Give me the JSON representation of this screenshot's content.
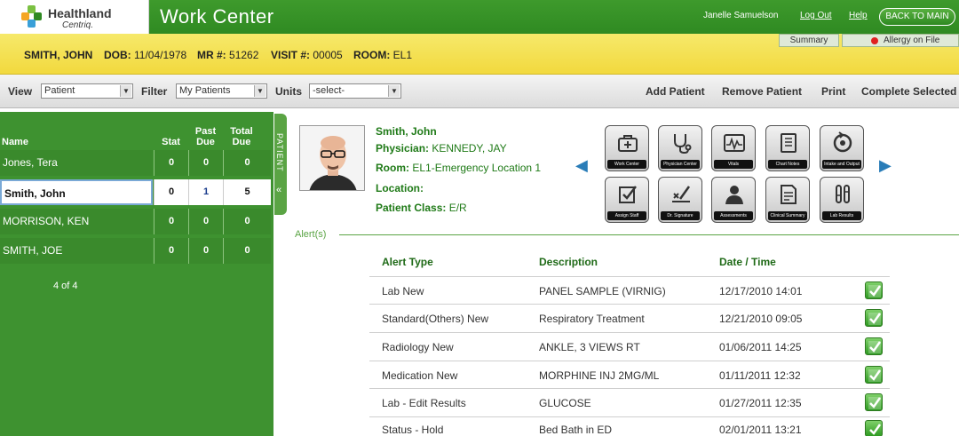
{
  "header": {
    "brand_line1": "Healthland",
    "brand_line2": "Centriq.",
    "title": "Work Center",
    "user": "Janelle Samuelson",
    "logout": "Log Out",
    "help": "Help",
    "back_button": "BACK TO MAIN"
  },
  "banner": {
    "name": "SMITH, JOHN",
    "dob_label": "DOB:",
    "dob": "11/04/1978",
    "mr_label": "MR #:",
    "mr": "51262",
    "visit_label": "VISIT #:",
    "visit": "00005",
    "room_label": "ROOM:",
    "room": "EL1",
    "summary_tab": "Summary",
    "allergy_tab": "Allergy on File"
  },
  "toolbar": {
    "view_label": "View",
    "view_value": "Patient",
    "filter_label": "Filter",
    "filter_value": "My Patients",
    "units_label": "Units",
    "units_value": "-select-",
    "actions": [
      "Add Patient",
      "Remove Patient",
      "Print",
      "Complete Selected"
    ]
  },
  "patient_list": {
    "columns": {
      "name": "Name",
      "stat": "Stat",
      "past_due": "Past Due",
      "total_due": "Total Due"
    },
    "rows": [
      {
        "name": "Jones, Tera",
        "stat": "0",
        "past_due": "0",
        "total_due": "0"
      },
      {
        "name": "Smith, John",
        "stat": "0",
        "past_due": "1",
        "total_due": "5"
      },
      {
        "name": "MORRISON, KEN",
        "stat": "0",
        "past_due": "0",
        "total_due": "0"
      },
      {
        "name": "SMITH, JOE",
        "stat": "0",
        "past_due": "0",
        "total_due": "0"
      }
    ],
    "selected_index": 1,
    "count_text": "4 of 4",
    "side_tab": "PATIENT"
  },
  "patient_detail": {
    "name": "Smith, John",
    "physician_label": "Physician:",
    "physician": "KENNEDY, JAY",
    "room_label": "Room:",
    "room": "EL1-Emergency Location 1",
    "location_label": "Location:",
    "location": "",
    "class_label": "Patient Class:",
    "class": "E/R"
  },
  "icons": [
    {
      "label": "Work Center",
      "icon": "work-center-icon"
    },
    {
      "label": "Physician Center",
      "icon": "stethoscope-icon"
    },
    {
      "label": "Vitals",
      "icon": "vitals-icon"
    },
    {
      "label": "Chart Notes",
      "icon": "chart-notes-icon"
    },
    {
      "label": "Intake and Output",
      "icon": "intake-output-icon"
    },
    {
      "label": "Assign Staff",
      "icon": "assign-staff-icon"
    },
    {
      "label": "Dr. Signature",
      "icon": "signature-icon"
    },
    {
      "label": "Assessments",
      "icon": "assessments-icon"
    },
    {
      "label": "Clinical Summary",
      "icon": "clinical-summary-icon"
    },
    {
      "label": "Lab Results",
      "icon": "lab-results-icon"
    }
  ],
  "alerts": {
    "section_label": "Alert(s)",
    "columns": {
      "type": "Alert Type",
      "description": "Description",
      "datetime": "Date / Time"
    },
    "rows": [
      {
        "type": "Lab New",
        "description": "PANEL SAMPLE (VIRNIG)",
        "datetime": "12/17/2010 14:01"
      },
      {
        "type": "Standard(Others) New",
        "description": "Respiratory Treatment",
        "datetime": "12/21/2010 09:05"
      },
      {
        "type": "Radiology New",
        "description": "ANKLE, 3 VIEWS RT",
        "datetime": "01/06/2011 14:25"
      },
      {
        "type": "Medication New",
        "description": "MORPHINE INJ 2MG/ML",
        "datetime": "01/11/2011 12:32"
      },
      {
        "type": "Lab - Edit Results",
        "description": "GLUCOSE",
        "datetime": "01/27/2011 12:35"
      },
      {
        "type": "Status - Hold",
        "description": "Bed Bath in ED",
        "datetime": "02/01/2011 13:21"
      }
    ]
  },
  "colors": {
    "brand_green": "#2f8a22",
    "banner_yellow": "#f2d93e",
    "allergy_red": "#e02020",
    "nav_arrow_blue": "#2a7db8"
  }
}
